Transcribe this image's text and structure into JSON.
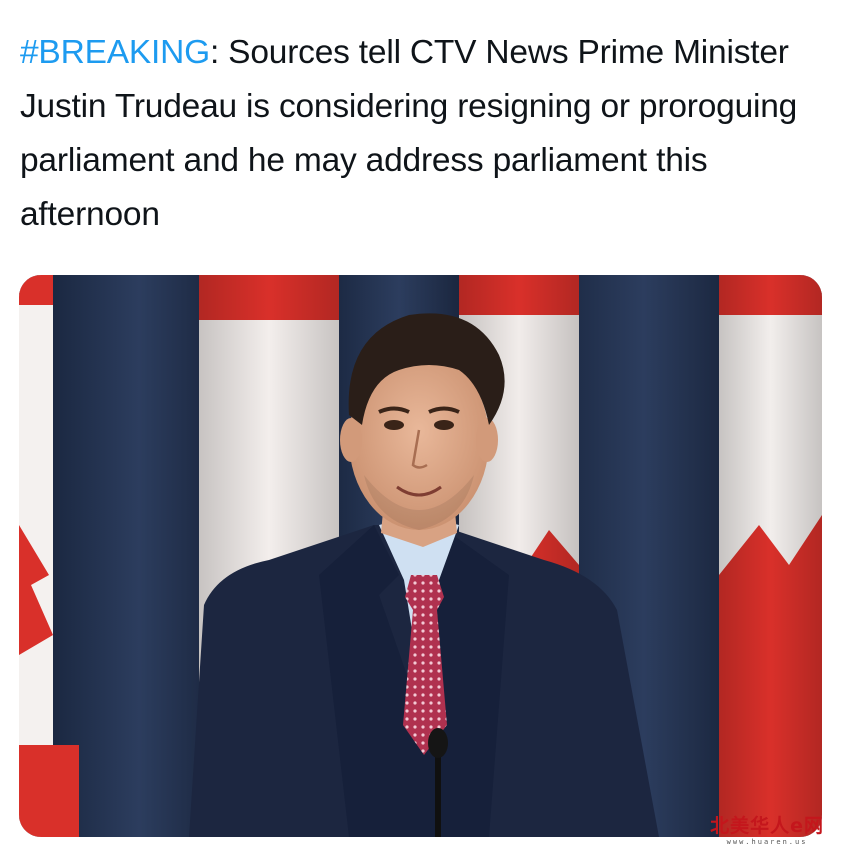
{
  "post": {
    "hashtag": "#BREAKING",
    "text": ": Sources tell CTV News Prime Minister Justin Trudeau is considering resigning or proroguing parliament and he may address parliament this afternoon"
  },
  "media": {
    "subject": "man in dark suit and pink tie in front of Canadian flags and a microphone"
  },
  "watermark": {
    "main": "北美华人e网",
    "sub": "www.huaren.us"
  },
  "colors": {
    "hashtag": "#1d9bf0",
    "text": "#0f1419",
    "flag_red": "#d9302a",
    "backdrop_blue": "#1d2a44",
    "watermark_red": "#c4161c"
  }
}
